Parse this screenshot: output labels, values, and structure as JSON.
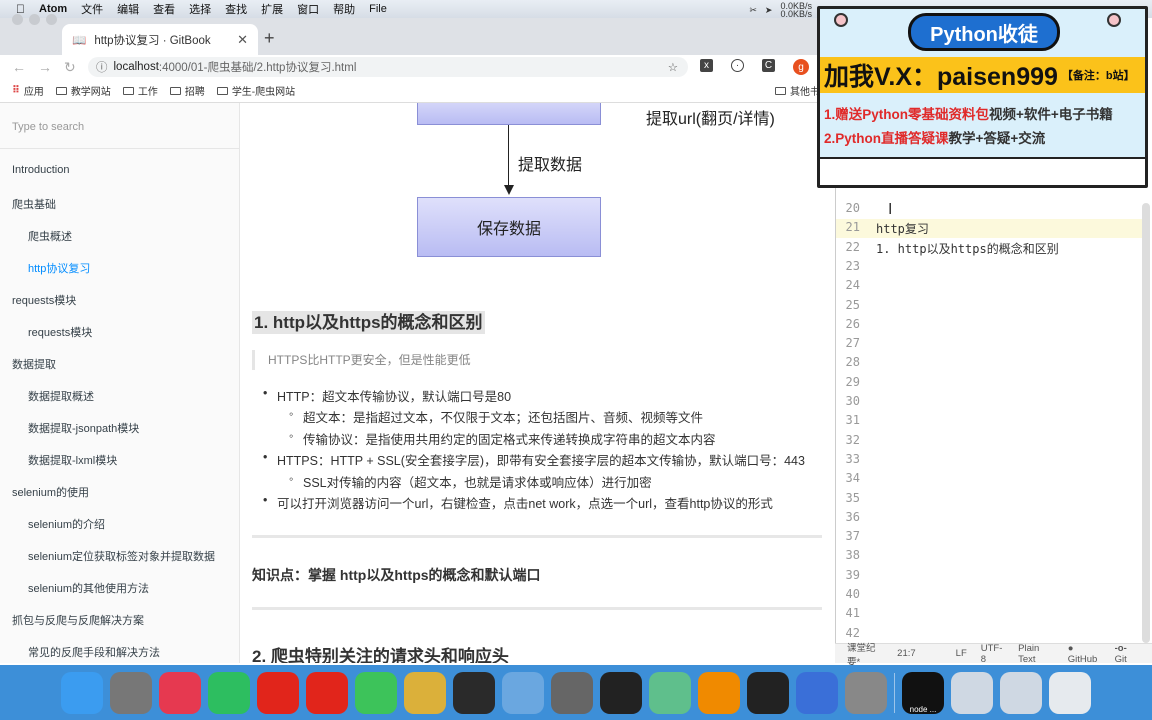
{
  "menubar": {
    "app": "Atom",
    "items": [
      "文件",
      "编辑",
      "查看",
      "选择",
      "查找",
      "扩展",
      "窗口",
      "帮助",
      "File"
    ],
    "net_up": "0.0KB/s",
    "net_down": "0.0KB/s"
  },
  "browser": {
    "tab_title": "http协议复习 · GitBook",
    "url_host": "localhost",
    "url_path": ":4000/01-爬虫基础/2.http协议复习.html",
    "bookmarks": [
      "应用",
      "教学网站",
      "工作",
      "招聘",
      "学生-爬虫网站"
    ],
    "other_bookmarks": "其他书签",
    "profile_initial": "g"
  },
  "sidebar": {
    "search_placeholder": "Type to search",
    "items": [
      {
        "label": "Introduction",
        "level": 0
      },
      {
        "label": "爬虫基础",
        "level": 0
      },
      {
        "label": "爬虫概述",
        "level": 1
      },
      {
        "label": "http协议复习",
        "level": 1,
        "active": true
      },
      {
        "label": "requests模块",
        "level": 0
      },
      {
        "label": "requests模块",
        "level": 1
      },
      {
        "label": "数据提取",
        "level": 0
      },
      {
        "label": "数据提取概述",
        "level": 1
      },
      {
        "label": "数据提取-jsonpath模块",
        "level": 1
      },
      {
        "label": "数据提取-lxml模块",
        "level": 1
      },
      {
        "label": "selenium的使用",
        "level": 0
      },
      {
        "label": "selenium的介绍",
        "level": 1
      },
      {
        "label": "selenium定位获取标签对象并提取数据",
        "level": 1
      },
      {
        "label": "selenium的其他使用方法",
        "level": 1
      },
      {
        "label": "抓包与反爬与反爬解决方案",
        "level": 0
      },
      {
        "label": "常见的反爬手段和解决方法",
        "level": 1
      }
    ]
  },
  "main": {
    "diagram": {
      "right_label": "提取url(翻页/详情)",
      "arrow_label": "提取数据",
      "box_label": "保存数据"
    },
    "section1_title": "1. http以及https的概念和区别",
    "quote": "HTTPS比HTTP更安全，但是性能更低",
    "bullets": [
      {
        "text": "HTTP：超文本传输协议，默认端口号是80",
        "level": 0
      },
      {
        "text": "超文本：是指超过文本，不仅限于文本；还包括图片、音频、视频等文件",
        "level": 1
      },
      {
        "text": "传输协议：是指使用共用约定的固定格式来传递转换成字符串的超文本内容",
        "level": 1
      },
      {
        "text": "HTTPS：HTTP + SSL(安全套接字层)，即带有安全套接字层的超本文传输协，默认端口号：443",
        "level": 0
      },
      {
        "text": "SSL对传输的内容（超文本，也就是请求体或响应体）进行加密",
        "level": 1
      },
      {
        "text": "可以打开浏览器访问一个url，右键检查，点击net work，点选一个url，查看http协议的形式",
        "level": 0
      }
    ],
    "knowledge": "知识点：掌握 http以及https的概念和默认端口",
    "section2_title": "2. 爬虫特别关注的请求头和响应头"
  },
  "editor": {
    "lines": [
      {
        "n": "20",
        "t": ""
      },
      {
        "n": "21",
        "t": "http复习"
      },
      {
        "n": "22",
        "t": "1. http以及https的概念和区别"
      },
      {
        "n": "23",
        "t": ""
      },
      {
        "n": "24",
        "t": ""
      },
      {
        "n": "25",
        "t": ""
      },
      {
        "n": "26",
        "t": ""
      },
      {
        "n": "27",
        "t": ""
      },
      {
        "n": "28",
        "t": ""
      },
      {
        "n": "29",
        "t": ""
      },
      {
        "n": "30",
        "t": ""
      },
      {
        "n": "31",
        "t": ""
      },
      {
        "n": "32",
        "t": ""
      },
      {
        "n": "33",
        "t": ""
      },
      {
        "n": "34",
        "t": ""
      },
      {
        "n": "35",
        "t": ""
      },
      {
        "n": "36",
        "t": ""
      },
      {
        "n": "37",
        "t": ""
      },
      {
        "n": "38",
        "t": ""
      },
      {
        "n": "39",
        "t": ""
      },
      {
        "n": "40",
        "t": ""
      },
      {
        "n": "41",
        "t": ""
      },
      {
        "n": "42",
        "t": ""
      }
    ],
    "status": {
      "file": "课堂纪要*",
      "cursor": "21:7",
      "line_ending": "LF",
      "encoding": "UTF-8",
      "grammar": "Plain Text",
      "github": "GitHub",
      "git": "Git"
    }
  },
  "ad": {
    "title": "Python收徒",
    "contact": "加我V.X：paisen999",
    "note": "【备注：b站】",
    "line1_red": "1.赠送Python零基础资料包",
    "line1_black": "视频+软件+电子书籍",
    "line2_red": "2.Python直播答疑课",
    "line2_black": "教学+答疑+交流"
  },
  "dock": {
    "apps": [
      {
        "name": "finder",
        "color": "#3b9cf0"
      },
      {
        "name": "launchpad",
        "color": "#777"
      },
      {
        "name": "xmind",
        "color": "#e63950"
      },
      {
        "name": "evernote",
        "color": "#2dbe60"
      },
      {
        "name": "netease-music",
        "color": "#e1251b"
      },
      {
        "name": "youdao",
        "color": "#e1251b"
      },
      {
        "name": "mindnode",
        "color": "#3dc35a"
      },
      {
        "name": "chrome",
        "color": "#dbb03a"
      },
      {
        "name": "pycharm",
        "color": "#2a2a2a"
      },
      {
        "name": "keynote",
        "color": "#6aa7e0"
      },
      {
        "name": "system-preferences",
        "color": "#666"
      },
      {
        "name": "terminal",
        "color": "#222"
      },
      {
        "name": "atom",
        "color": "#5fbf8c"
      },
      {
        "name": "vlc",
        "color": "#f08a00"
      },
      {
        "name": "obs",
        "color": "#222"
      },
      {
        "name": "parallels",
        "color": "#3a6fd8"
      },
      {
        "name": "sublime",
        "color": "#888"
      }
    ],
    "node_label": "node ..."
  }
}
